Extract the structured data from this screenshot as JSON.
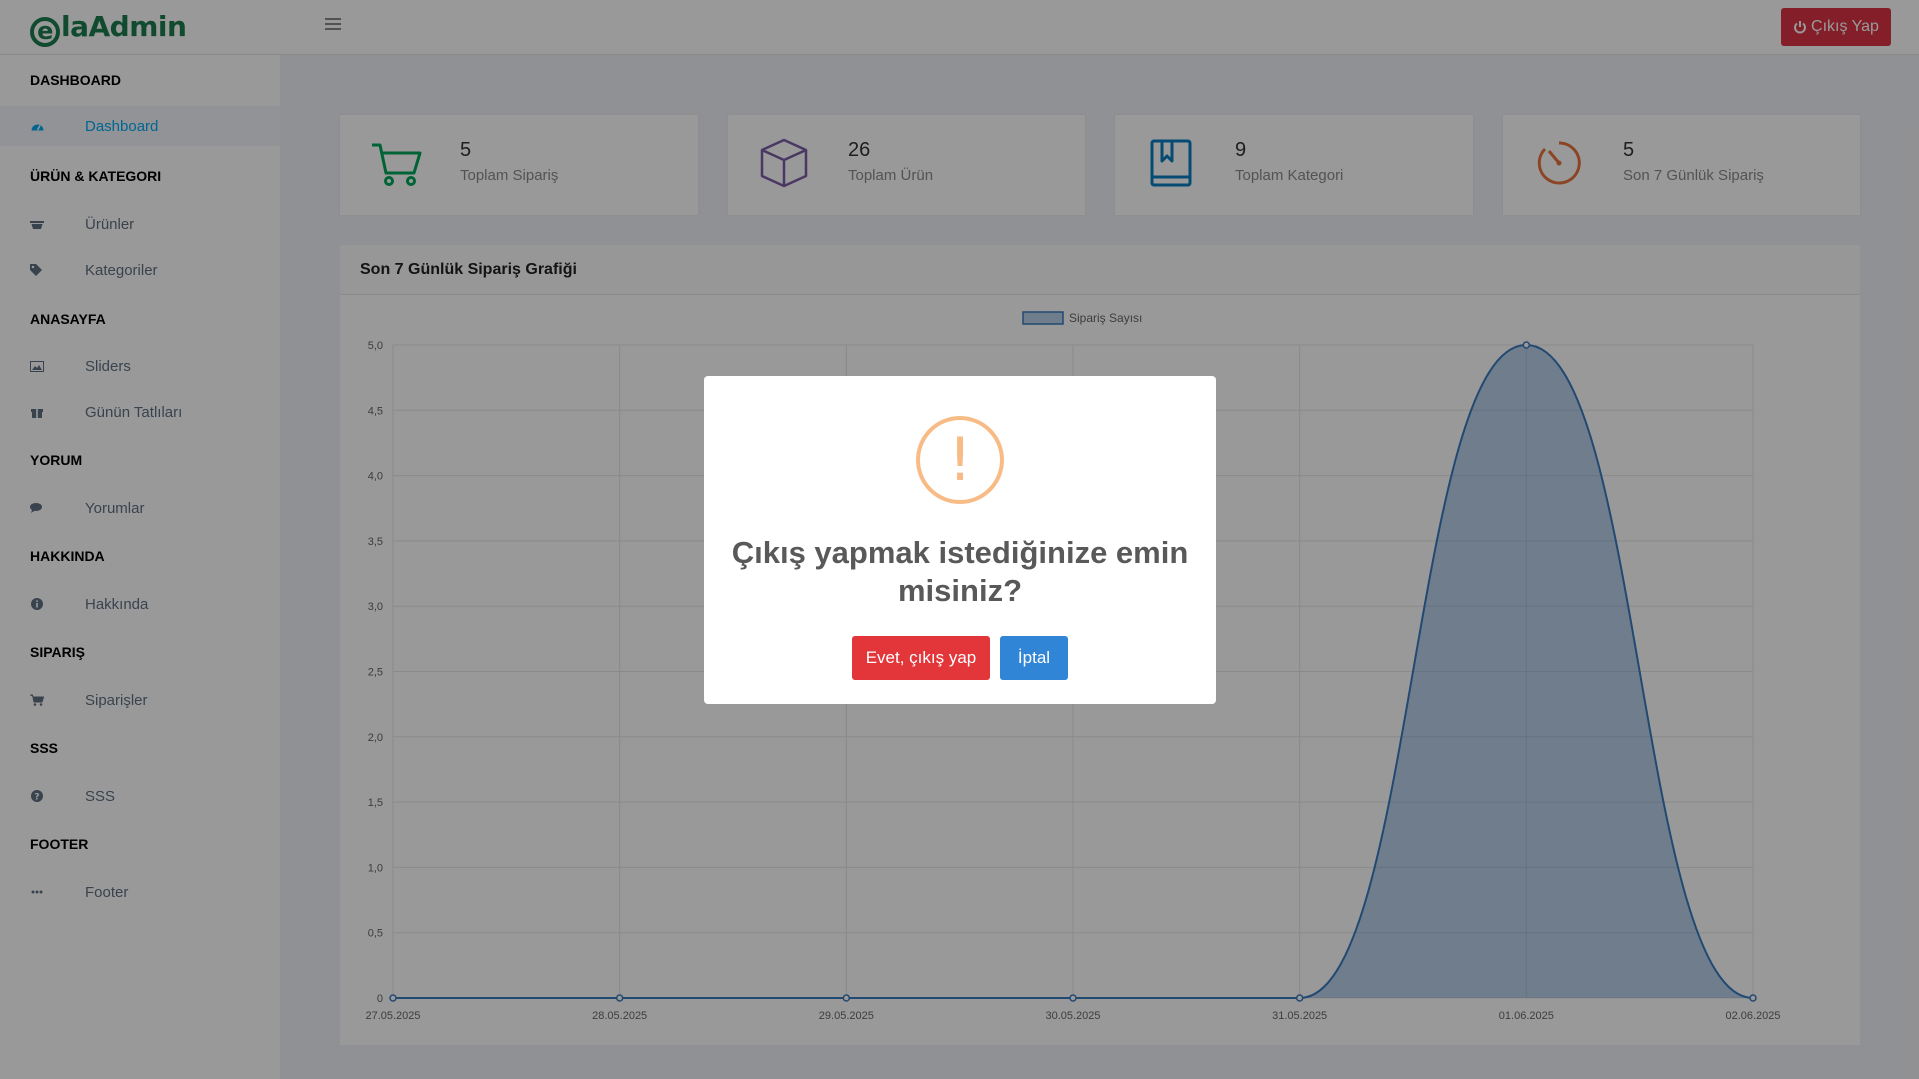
{
  "app": {
    "logo_text": "laAdmin",
    "logo_letter": "e",
    "menu_icon": "hamburger-icon"
  },
  "header": {
    "logout_label": "Çıkış Yap",
    "logout_icon": "power-icon"
  },
  "sidebar": {
    "sections": [
      {
        "title": "DASHBOARD",
        "items": [
          {
            "label": "Dashboard",
            "icon": "dashboard-icon",
            "active": true
          }
        ]
      },
      {
        "title": "ÜRÜN & KATEGORI",
        "items": [
          {
            "label": "Ürünler",
            "icon": "basket-icon"
          },
          {
            "label": "Kategoriler",
            "icon": "tags-icon"
          }
        ]
      },
      {
        "title": "ANASAYFA",
        "items": [
          {
            "label": "Sliders",
            "icon": "image-icon"
          },
          {
            "label": "Günün Tatlıları",
            "icon": "gift-icon"
          }
        ]
      },
      {
        "title": "YORUM",
        "items": [
          {
            "label": "Yorumlar",
            "icon": "comments-icon"
          }
        ]
      },
      {
        "title": "HAKKINDA",
        "items": [
          {
            "label": "Hakkında",
            "icon": "info-icon"
          }
        ]
      },
      {
        "title": "SIPARIŞ",
        "items": [
          {
            "label": "Siparişler",
            "icon": "cart-icon"
          }
        ]
      },
      {
        "title": "SSS",
        "items": [
          {
            "label": "SSS",
            "icon": "question-icon"
          }
        ]
      },
      {
        "title": "FOOTER",
        "items": [
          {
            "label": "Footer",
            "icon": "ellipsis-icon"
          }
        ]
      }
    ]
  },
  "stats": [
    {
      "value": "5",
      "label": "Toplam Sipariş",
      "icon": "cart-icon",
      "color": "#00a65a"
    },
    {
      "value": "26",
      "label": "Toplam Ürün",
      "icon": "cube-icon",
      "color": "#7b5ea7"
    },
    {
      "value": "9",
      "label": "Toplam Kategori",
      "icon": "book-icon",
      "color": "#0a7dc2"
    },
    {
      "value": "5",
      "label": "Son 7 Günlük Sipariş",
      "icon": "timer-icon",
      "color": "#e8733e"
    }
  ],
  "chart_card": {
    "title": "Son 7 Günlük Sipariş Grafiği"
  },
  "chart_data": {
    "type": "area",
    "title": "",
    "xlabel": "",
    "ylabel": "",
    "categories": [
      "27.05.2025",
      "28.05.2025",
      "29.05.2025",
      "30.05.2025",
      "31.05.2025",
      "01.06.2025",
      "02.06.2025"
    ],
    "series": [
      {
        "name": "Sipariş Sayısı",
        "values": [
          0,
          0,
          0,
          0,
          0,
          5,
          0
        ],
        "color": "#3a7bbf"
      }
    ],
    "ylim": [
      0,
      5
    ],
    "yticks": [
      "0",
      "0,5",
      "1,0",
      "1,5",
      "2,0",
      "2,5",
      "3,0",
      "3,5",
      "4,0",
      "4,5",
      "5,0"
    ],
    "grid": true,
    "legend": "top-center"
  },
  "dialog": {
    "icon": "warning-icon",
    "icon_glyph": "!",
    "title": "Çıkış yapmak istediğinize emin misiniz?",
    "confirm_label": "Evet, çıkış yap",
    "cancel_label": "İptal"
  }
}
